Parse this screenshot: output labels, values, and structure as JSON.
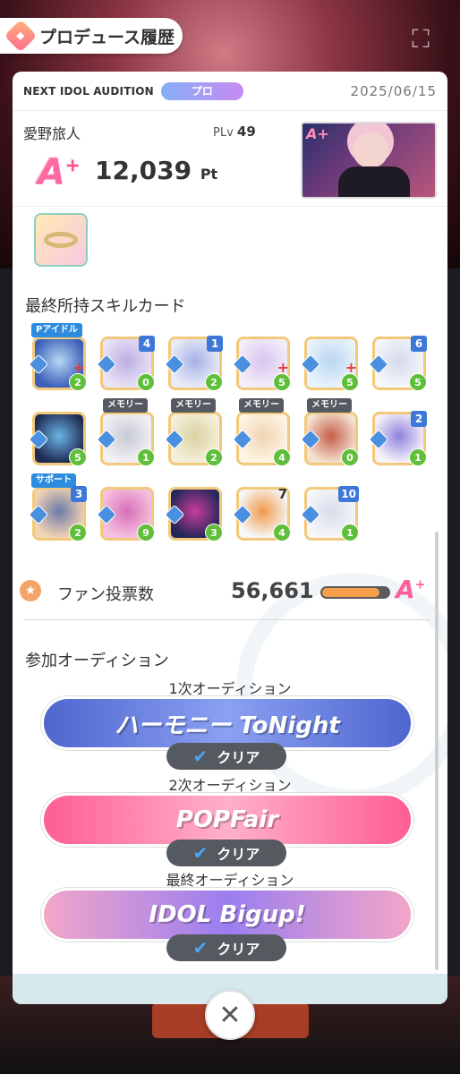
{
  "header": {
    "title": "プロデュース履歴"
  },
  "audition": {
    "name": "NEXT IDOL AUDITION",
    "difficulty": "プロ",
    "date": "2025/06/15"
  },
  "producer": {
    "name": "愛野旅人",
    "plv_label": "PLv",
    "plv_value": "49",
    "grade": "A",
    "grade_suffix": "+",
    "score": "12,039",
    "score_unit": "Pt"
  },
  "item": {
    "icon": "bracelet-icon"
  },
  "skill_cards": {
    "title": "最終所持スキルカード",
    "cards": [
      {
        "tag": "Pアイドル",
        "tag_type": "pidol",
        "cost": "",
        "value": "2",
        "plus": true,
        "colors": [
          "#3b5fb8",
          "#b7d9f5"
        ]
      },
      {
        "tag": "",
        "cost": "4",
        "value": "0",
        "plus": false,
        "colors": [
          "#e9e3f5",
          "#bcaee4"
        ]
      },
      {
        "tag": "",
        "cost": "1",
        "value": "2",
        "plus": false,
        "colors": [
          "#e9ecf7",
          "#a6b1e6"
        ]
      },
      {
        "tag": "",
        "cost": "",
        "value": "5",
        "plus": true,
        "colors": [
          "#f3eef9",
          "#d8c3ef"
        ]
      },
      {
        "tag": "",
        "cost": "",
        "value": "5",
        "plus": true,
        "colors": [
          "#e9f3fb",
          "#b9d6ef"
        ]
      },
      {
        "tag": "",
        "cost": "6",
        "value": "5",
        "plus": false,
        "colors": [
          "#f6f6fb",
          "#d2daea"
        ]
      },
      {
        "tag": "",
        "cost": "",
        "value": "5",
        "plus": false,
        "colors": [
          "#1f2b54",
          "#6bb5e5"
        ]
      },
      {
        "tag": "メモリー",
        "tag_type": "memory",
        "cost": "",
        "value": "1",
        "plus": false,
        "colors": [
          "#f1f1f4",
          "#c8cad6"
        ]
      },
      {
        "tag": "メモリー",
        "tag_type": "memory",
        "cost": "",
        "value": "2",
        "plus": false,
        "colors": [
          "#f6efdc",
          "#d9d3a0"
        ]
      },
      {
        "tag": "メモリー",
        "tag_type": "memory",
        "cost": "",
        "value": "4",
        "plus": false,
        "colors": [
          "#fff4e4",
          "#f0d3b3"
        ]
      },
      {
        "tag": "メモリー",
        "tag_type": "memory",
        "cost": "",
        "value": "0",
        "plus": false,
        "colors": [
          "#f3e2cf",
          "#c65c4a"
        ]
      },
      {
        "tag": "",
        "cost": "2",
        "value": "1",
        "plus": false,
        "colors": [
          "#f7f2fa",
          "#8f82dd"
        ]
      },
      {
        "tag": "サポート",
        "tag_type": "support",
        "cost": "3",
        "value": "2",
        "plus": false,
        "colors": [
          "#f3d4b4",
          "#6c7aa8"
        ]
      },
      {
        "tag": "",
        "cost": "",
        "value": "9",
        "plus": false,
        "colors": [
          "#f5c0de",
          "#d86fb7"
        ]
      },
      {
        "tag": "",
        "cost": "",
        "value": "3",
        "plus": false,
        "colors": [
          "#23275a",
          "#ca3d9c"
        ]
      },
      {
        "tag": "",
        "cost": "7",
        "cost_plain": true,
        "value": "4",
        "plus": false,
        "colors": [
          "#f7f7f7",
          "#f09a4a"
        ]
      },
      {
        "tag": "",
        "cost": "10",
        "value": "1",
        "plus": false,
        "colors": [
          "#f7f7fa",
          "#d7dcea"
        ]
      }
    ]
  },
  "fan_votes": {
    "label": "ファン投票数",
    "value": "56,661",
    "bar_fraction": 0.86,
    "grade": "A",
    "grade_suffix": "+"
  },
  "auditions_section": {
    "title": "参加オーディション",
    "stages": [
      {
        "label": "1次オーディション",
        "logo": "ハーモニー ToNight",
        "status": "クリア",
        "colors": [
          "#4f66cf",
          "#8aa0f2"
        ]
      },
      {
        "label": "2次オーディション",
        "logo": "POPFair",
        "status": "クリア",
        "colors": [
          "#ff5e93",
          "#ffb0c9"
        ]
      },
      {
        "label": "最終オーディション",
        "logo": "IDOL Bigup!",
        "status": "クリア",
        "colors": [
          "#f3a6c8",
          "#9a7ef0"
        ]
      }
    ]
  },
  "close": {
    "icon": "close-icon",
    "label": "✕"
  }
}
